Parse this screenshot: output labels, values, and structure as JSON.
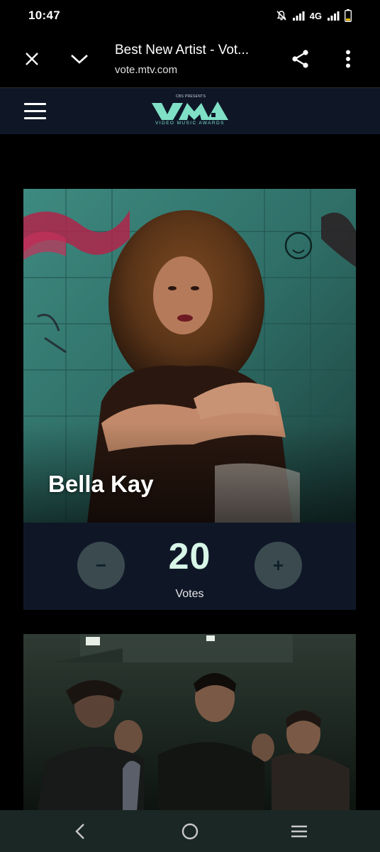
{
  "status_bar": {
    "time": "10:47",
    "network": "4G",
    "icons": [
      "mute-bell-icon",
      "signal-icon",
      "signal-icon",
      "battery-icon"
    ]
  },
  "browser": {
    "title": "Best New Artist - Vot...",
    "url": "vote.mtv.com",
    "icons": [
      "close-icon",
      "chevron-down-icon",
      "share-icon",
      "more-vert-icon"
    ]
  },
  "site": {
    "logo_presents": "CBS PRESENTS",
    "logo_subtitle": "VIDEO MUSIC AWARDS",
    "logo_alt": "VMA",
    "menu_icon": "hamburger-icon"
  },
  "nominees": [
    {
      "name": "Bella Kay",
      "votes": "20",
      "votes_label": "Votes",
      "minus_label": "−",
      "plus_label": "+"
    }
  ],
  "colors": {
    "background": "#000000",
    "header_bg": "#0f1727",
    "vote_count": "#d8f6e8",
    "vote_button": "#3a4a4f",
    "logo_accent": "#7fe0c6",
    "nav_bar": "#1b2724"
  },
  "nav_bar": {
    "icons": [
      "back-icon",
      "home-icon",
      "recents-icon"
    ]
  }
}
